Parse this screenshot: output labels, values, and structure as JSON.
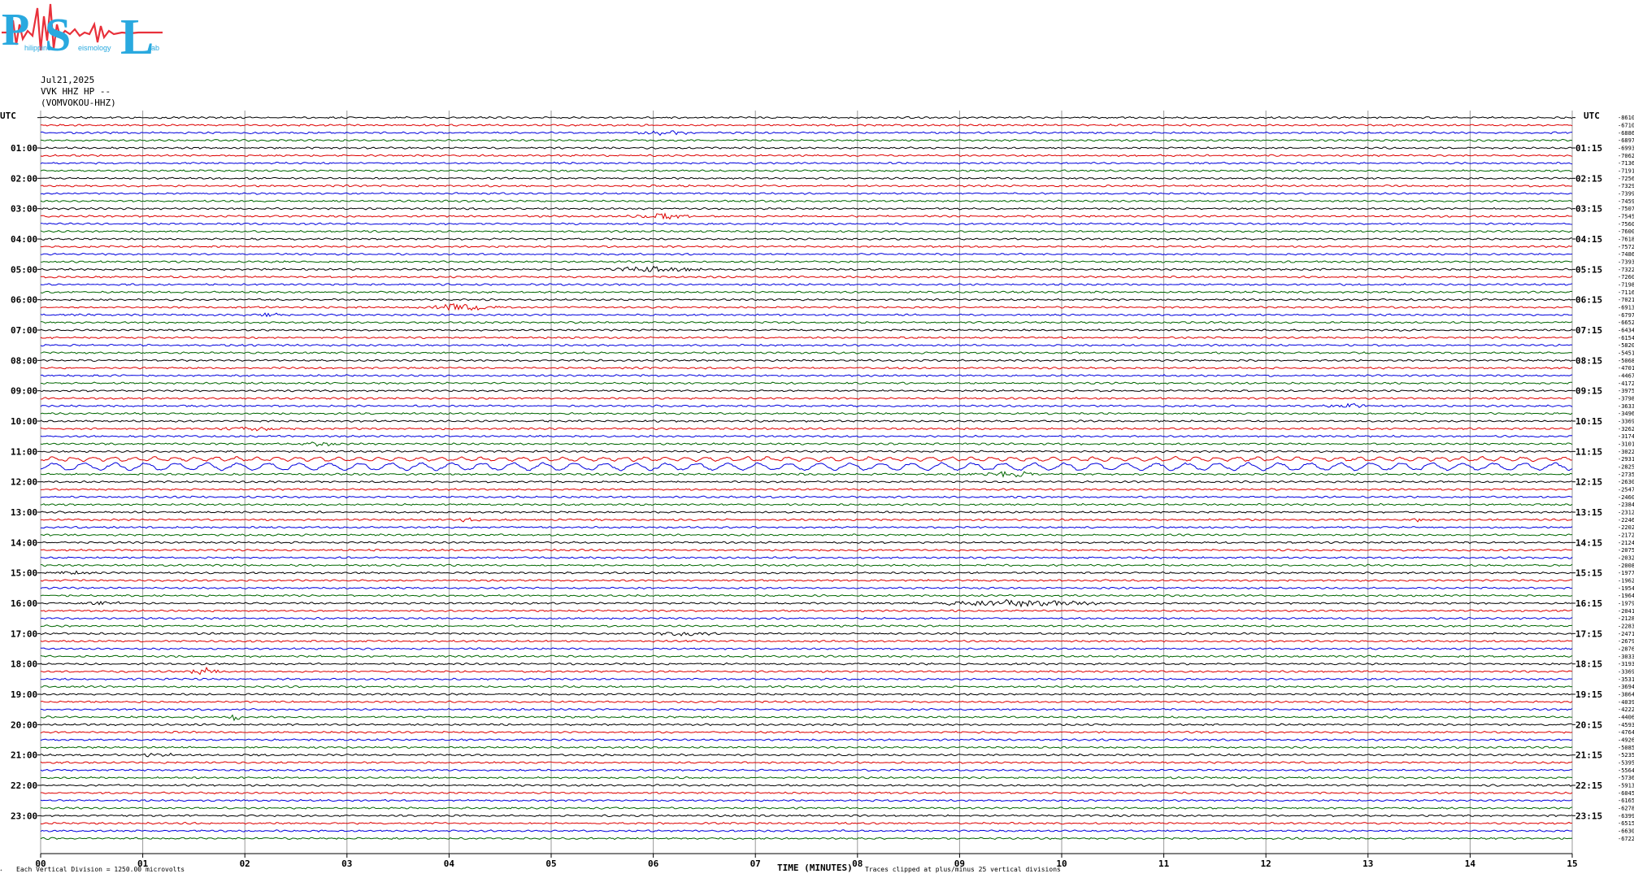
{
  "logo": {
    "letters": [
      "P",
      "S",
      "L"
    ],
    "words": [
      "hilippine",
      "eismology",
      "ab"
    ],
    "colors": {
      "letters": "#29a9df",
      "wave": "#e8303a"
    }
  },
  "header": {
    "date": "Jul21,2025",
    "station": "VVK HHZ HP --",
    "channel": "(VOMVOKOU-HHZ)"
  },
  "chart_data": {
    "type": "line",
    "title": "",
    "left_axis_title": "UTC",
    "right_axis_title": "UTC",
    "left_hour_labels": [
      "01:00",
      "02:00",
      "03:00",
      "04:00",
      "05:00",
      "06:00",
      "07:00",
      "08:00",
      "09:00",
      "10:00",
      "11:00",
      "12:00",
      "13:00",
      "14:00",
      "15:00",
      "16:00",
      "17:00",
      "18:00",
      "19:00",
      "20:00",
      "21:00",
      "22:00",
      "23:00"
    ],
    "right_hour_labels": [
      "01:15",
      "02:15",
      "03:15",
      "04:15",
      "05:15",
      "06:15",
      "07:15",
      "08:15",
      "09:15",
      "10:15",
      "11:15",
      "12:15",
      "13:15",
      "14:15",
      "15:15",
      "16:15",
      "17:15",
      "18:15",
      "19:15",
      "20:15",
      "21:15",
      "22:15",
      "23:15"
    ],
    "x_ticks": [
      "00",
      "01",
      "02",
      "03",
      "04",
      "05",
      "06",
      "07",
      "08",
      "09",
      "10",
      "11",
      "12",
      "13",
      "14",
      "15"
    ],
    "xlim": [
      0,
      15
    ],
    "xlabel": "TIME (MINUTES)",
    "trace_count": 96,
    "trace_minutes": 15,
    "trace_colors": [
      "#000000",
      "#dd0000",
      "#0000dd",
      "#006600"
    ],
    "grid": true,
    "trace_offsets": [
      -8610,
      -6710,
      -6886,
      -6897,
      -6993,
      -7062,
      -7136,
      -7191,
      -7256,
      -7329,
      -7399,
      -7459,
      -7507,
      -7545,
      -7560,
      -7600,
      -7618,
      -7572,
      -7486,
      -7393,
      -7322,
      -7260,
      -7198,
      -7116,
      -7021,
      -6913,
      -6797,
      -6652,
      -6434,
      -6154,
      -5820,
      -5451,
      -5068,
      -4701,
      -4467,
      -4172,
      -3975,
      -3798,
      -3633,
      -3496,
      -3369,
      -3262,
      -3174,
      -3101,
      -3022,
      -2931,
      -2825,
      -2735,
      -2630,
      -2547,
      -2460,
      -2384,
      -2312,
      -2246,
      -2202,
      -2172,
      -2124,
      -2075,
      -2032,
      -2008,
      -1977,
      -1962,
      -1954,
      -1964,
      -1979,
      -2041,
      -2128,
      -2283,
      -2471,
      -2679,
      -2876,
      -3033,
      -3193,
      -3369,
      -3531,
      -3694,
      -3864,
      -4039,
      -4222,
      -4406,
      -4593,
      -4764,
      -4926,
      -5085,
      -5235,
      -5395,
      -5564,
      -5736,
      -5913,
      -6045,
      -6165,
      -6278,
      -6399,
      -6515,
      -6630,
      -6722
    ],
    "events": [
      {
        "trace": 2,
        "minute": 6.1,
        "width_min": 0.4,
        "amp": 1.8
      },
      {
        "trace": 13,
        "minute": 6.1,
        "width_min": 0.4,
        "amp": 2.0
      },
      {
        "trace": 20,
        "minute": 6.0,
        "width_min": 0.7,
        "amp": 2.0
      },
      {
        "trace": 25,
        "minute": 4.1,
        "width_min": 0.5,
        "amp": 3.0
      },
      {
        "trace": 26,
        "minute": 2.2,
        "width_min": 0.3,
        "amp": 1.5
      },
      {
        "trace": 38,
        "minute": 12.8,
        "width_min": 0.3,
        "amp": 2.0
      },
      {
        "trace": 41,
        "minute": 2.1,
        "width_min": 0.5,
        "amp": 1.5
      },
      {
        "trace": 43,
        "minute": 2.7,
        "width_min": 0.4,
        "amp": 1.5
      },
      {
        "trace": 47,
        "minute": 9.5,
        "width_min": 0.5,
        "amp": 2.5
      },
      {
        "trace": 53,
        "minute": 4.2,
        "width_min": 0.2,
        "amp": 1.5
      },
      {
        "trace": 53,
        "minute": 13.5,
        "width_min": 0.2,
        "amp": 1.5
      },
      {
        "trace": 60,
        "minute": 0.3,
        "width_min": 0.3,
        "amp": 1.5
      },
      {
        "trace": 64,
        "minute": 0.6,
        "width_min": 0.3,
        "amp": 1.5
      },
      {
        "trace": 64,
        "minute": 9.5,
        "width_min": 1.2,
        "amp": 2.5
      },
      {
        "trace": 68,
        "minute": 6.3,
        "width_min": 0.4,
        "amp": 1.5
      },
      {
        "trace": 73,
        "minute": 1.6,
        "width_min": 0.2,
        "amp": 3.0
      },
      {
        "trace": 79,
        "minute": 1.9,
        "width_min": 0.1,
        "amp": 3.0
      },
      {
        "trace": 84,
        "minute": 1.1,
        "width_min": 0.3,
        "amp": 1.5
      }
    ],
    "long_period": [
      {
        "trace": 45,
        "amp": 2.0,
        "period_min": 0.2
      },
      {
        "trace": 46,
        "amp": 4.0,
        "period_min": 0.3
      }
    ]
  },
  "footer": {
    "scale_note": "Each Vertical Division = 1250.00 microvolts",
    "clip_note": "Traces clipped at plus/minus 25 vertical divisions",
    "corner_mark": "ᐩ"
  }
}
